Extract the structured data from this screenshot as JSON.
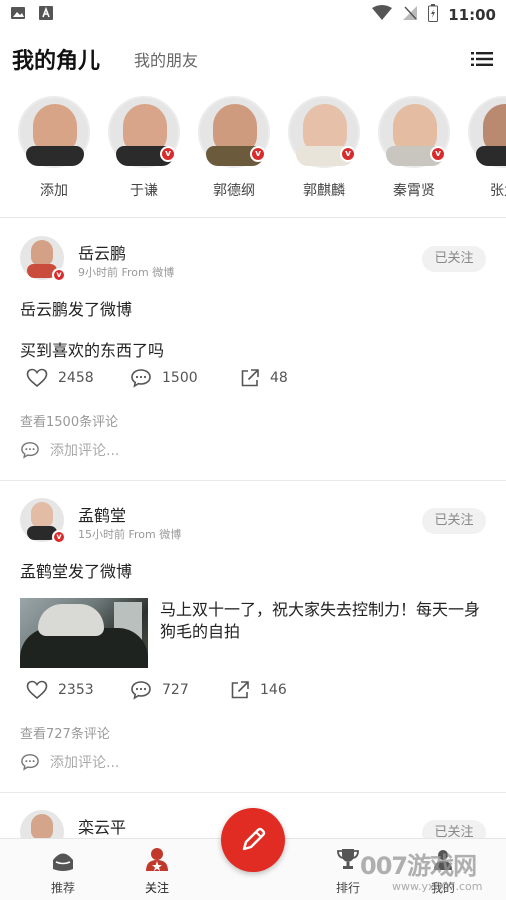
{
  "status_bar": {
    "time": "11:00"
  },
  "header": {
    "title": "我的角儿",
    "tab_friends": "我的朋友"
  },
  "strip": [
    {
      "name": "添加",
      "verified": false
    },
    {
      "name": "于谦",
      "verified": true
    },
    {
      "name": "郭德纲",
      "verified": true
    },
    {
      "name": "郭麒麟",
      "verified": true
    },
    {
      "name": "秦霄贤",
      "verified": true
    },
    {
      "name": "张九",
      "verified": false
    }
  ],
  "posts": [
    {
      "author": "岳云鹏",
      "time_text": "9小时前",
      "source": "From 微博",
      "follow_label": "已关注",
      "headline": "岳云鹏发了微博",
      "text": "买到喜欢的东西了吗",
      "likes": "2458",
      "comments": "1500",
      "shares": "48",
      "view_comments": "查看1500条评论",
      "add_comment": "添加评论..."
    },
    {
      "author": "孟鹤堂",
      "time_text": "15小时前",
      "source": "From 微博",
      "follow_label": "已关注",
      "headline": "孟鹤堂发了微博",
      "text": "马上双十一了，祝大家失去控制力！每天一身狗毛的自拍",
      "likes": "2353",
      "comments": "727",
      "shares": "146",
      "view_comments": "查看727条评论",
      "add_comment": "添加评论..."
    },
    {
      "author": "栾云平",
      "follow_label": "已关注"
    }
  ],
  "bottom_nav": {
    "items": [
      {
        "label": "推荐"
      },
      {
        "label": "关注"
      },
      {
        "label": "排行"
      },
      {
        "label": "我的"
      }
    ]
  },
  "watermark": {
    "top": "007游戏网",
    "bottom": "www.yx007.com"
  },
  "colors": {
    "accent": "#e02c22",
    "badge": "#d92b2b"
  }
}
